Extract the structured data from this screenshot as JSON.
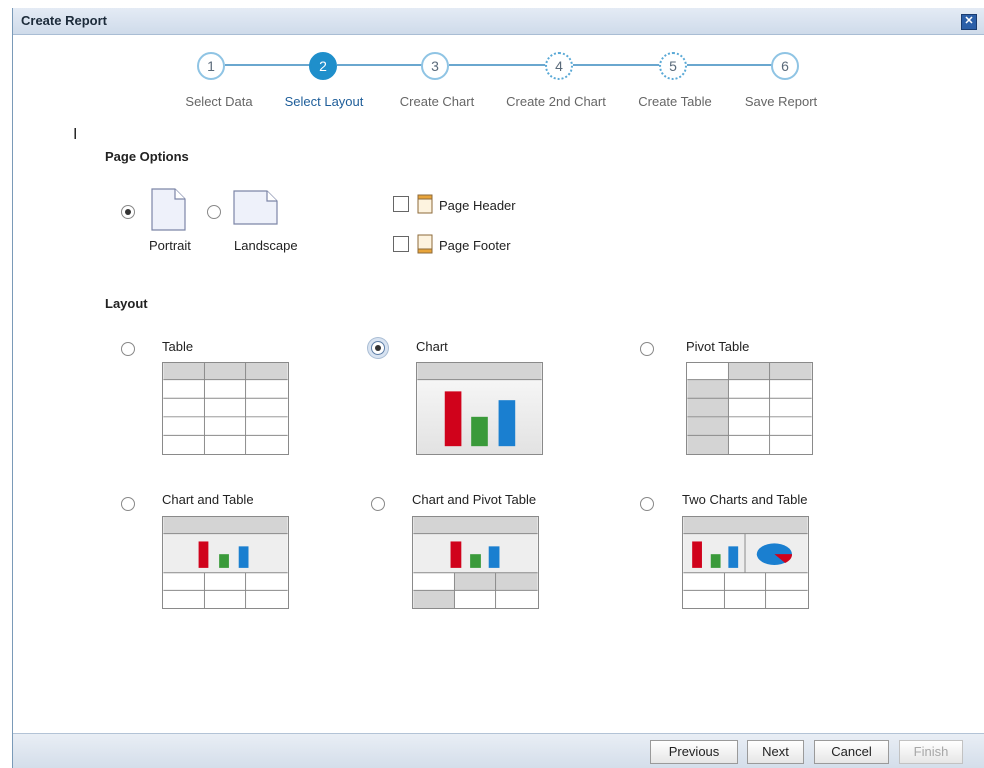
{
  "dialog": {
    "title": "Create Report"
  },
  "steps": [
    {
      "number": "1",
      "label": "Select Data"
    },
    {
      "number": "2",
      "label": "Select Layout"
    },
    {
      "number": "3",
      "label": "Create Chart"
    },
    {
      "number": "4",
      "label": "Create 2nd Chart"
    },
    {
      "number": "5",
      "label": "Create Table"
    },
    {
      "number": "6",
      "label": "Save Report"
    }
  ],
  "page_options": {
    "heading": "Page Options",
    "portrait_label": "Portrait",
    "landscape_label": "Landscape",
    "orientation_selected": "Portrait",
    "page_header_label": "Page Header",
    "page_footer_label": "Page Footer",
    "page_header_checked": false,
    "page_footer_checked": false
  },
  "layout": {
    "heading": "Layout",
    "selected": "Chart",
    "options": [
      "Table",
      "Chart",
      "Pivot Table",
      "Chart and Table",
      "Chart and Pivot Table",
      "Two Charts and Table"
    ]
  },
  "colors": {
    "accent": "#1f8fcb",
    "bar_red": "#d0021b",
    "bar_green": "#3a9a3a",
    "bar_blue": "#1a7fd0"
  },
  "footer": {
    "previous": "Previous",
    "next": "Next",
    "cancel": "Cancel",
    "finish": "Finish"
  }
}
